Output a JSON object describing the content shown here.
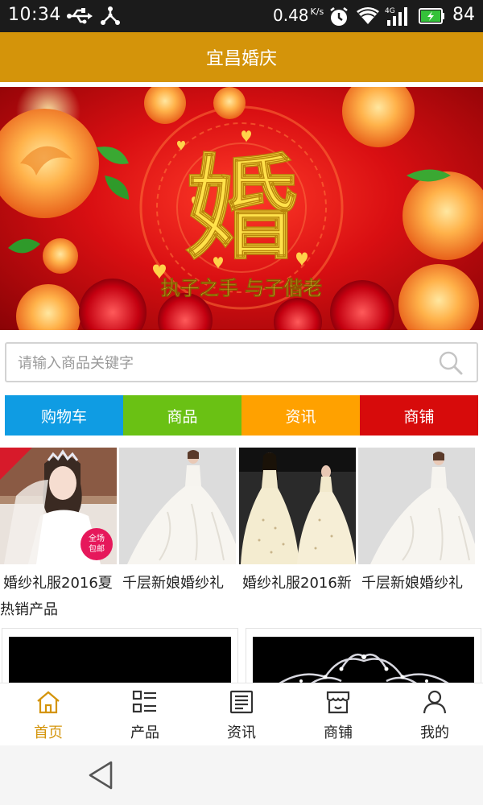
{
  "status_bar": {
    "time": "10:34",
    "net_speed": "0.48",
    "net_unit": "K/s",
    "signal_type": "4G",
    "battery": "84",
    "icons": [
      "usb-icon",
      "share-icon",
      "alarm-icon",
      "wifi-icon",
      "signal-icon",
      "battery-icon"
    ]
  },
  "app_bar": {
    "title": "宜昌婚庆"
  },
  "banner": {
    "main_char": "婚",
    "caption": "执子之手 与子偕老"
  },
  "search": {
    "placeholder": "请输入商品关键字"
  },
  "categories": [
    {
      "label": "购物车",
      "color": "#0f9ce3"
    },
    {
      "label": "商品",
      "color": "#6ac114"
    },
    {
      "label": "资讯",
      "color": "#ffa100"
    },
    {
      "label": "商铺",
      "color": "#d70b0b"
    }
  ],
  "products": [
    {
      "name": "婚纱礼服2016夏",
      "badge": "全场包邮"
    },
    {
      "name": "千层新娘婚纱礼"
    },
    {
      "name": "婚纱礼服2016新"
    },
    {
      "name": "千层新娘婚纱礼"
    }
  ],
  "section_label": "热销产品",
  "tabs": [
    {
      "label": "首页",
      "icon": "home-icon",
      "active": true
    },
    {
      "label": "产品",
      "icon": "list-icon",
      "active": false
    },
    {
      "label": "资讯",
      "icon": "news-icon",
      "active": false
    },
    {
      "label": "商铺",
      "icon": "store-icon",
      "active": false
    },
    {
      "label": "我的",
      "icon": "user-icon",
      "active": false
    }
  ],
  "colors": {
    "accent": "#d4940a",
    "tab_active": "#d4940a"
  }
}
